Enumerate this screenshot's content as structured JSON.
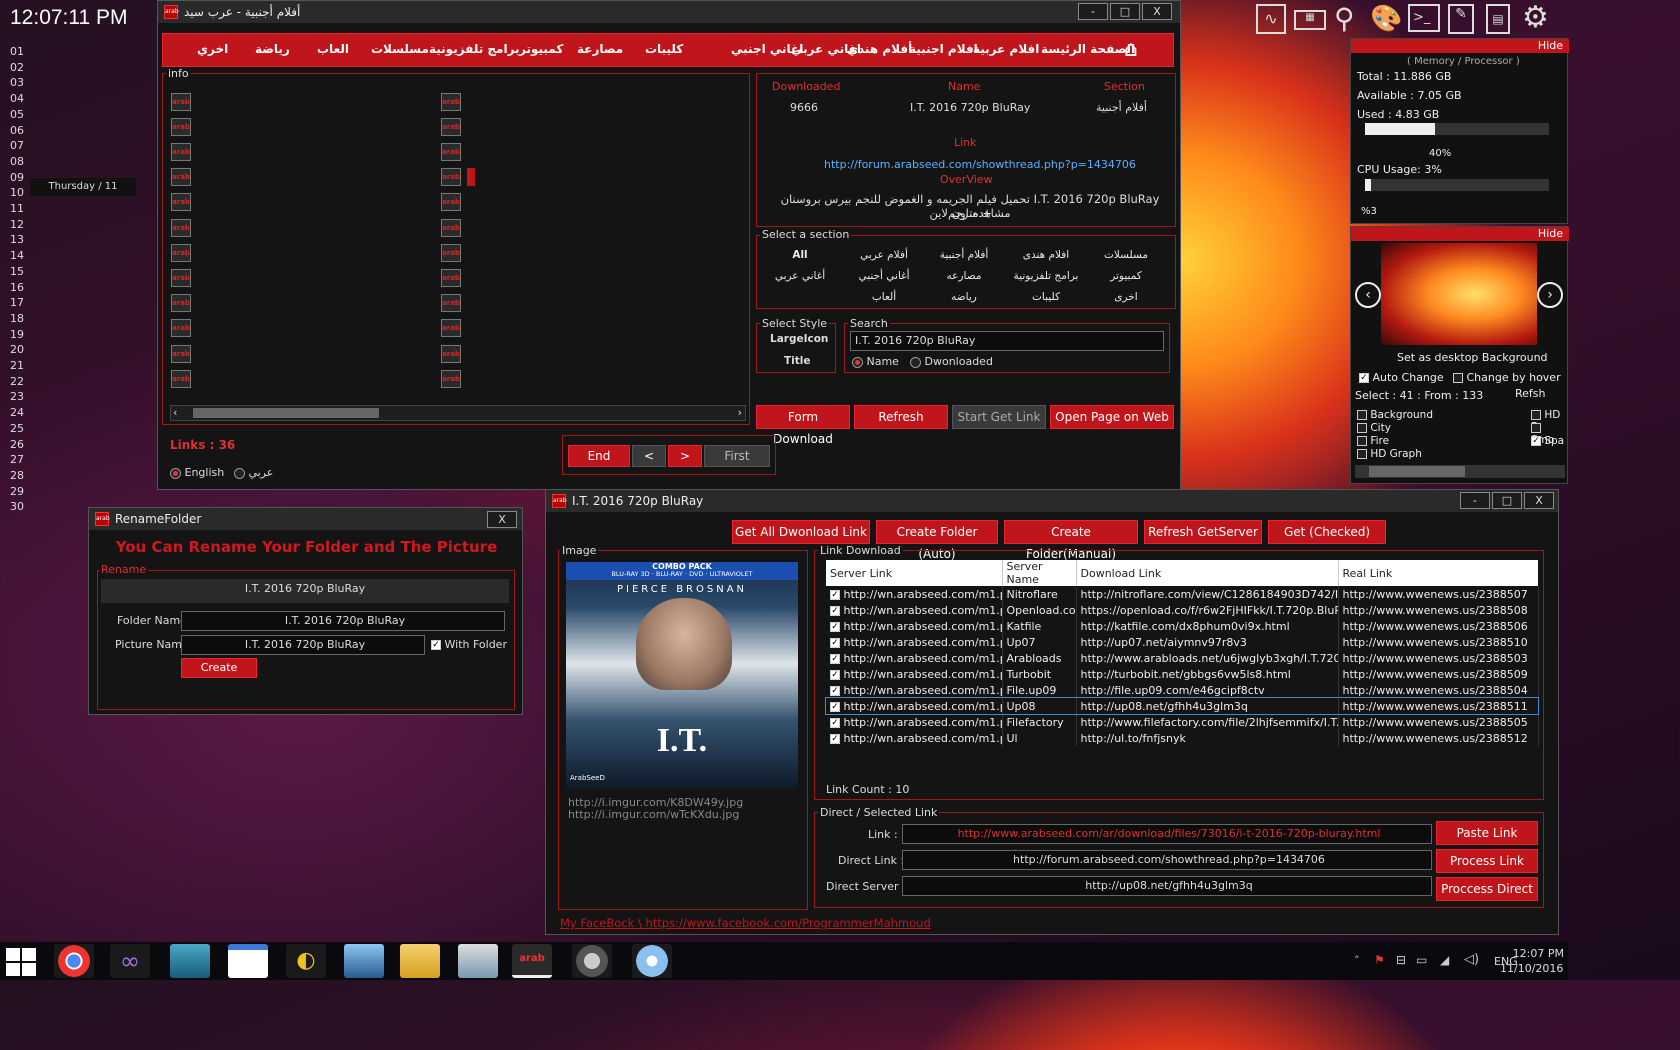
{
  "desktop": {
    "clock": "12:07:11 PM",
    "date_label": "Thursday / 11",
    "calendar_days": [
      "01",
      "02",
      "03",
      "04",
      "05",
      "06",
      "07",
      "08",
      "09",
      "10",
      "11",
      "12",
      "13",
      "14",
      "15",
      "16",
      "17",
      "18",
      "19",
      "20",
      "21",
      "22",
      "23",
      "24",
      "25",
      "26",
      "27",
      "28",
      "29",
      "30"
    ]
  },
  "main_window": {
    "title": "أفلام أجنبية - عرب سيد",
    "controls": [
      "-",
      "□",
      "X"
    ],
    "nav": [
      "الصفحة الرئيسة",
      "افلام عربية",
      "افلام اجنبية",
      "أفلام هندي",
      "اغاني عربي",
      "اغاني اجنبي",
      "كليبات",
      "مصارعة",
      "كمبيوتر",
      "برامج تلفزيونية",
      "مسلسلات",
      "العاب",
      "رياضة",
      "اخري"
    ],
    "info_label": "info",
    "list_left": [
      "فيلم اكشن و اثاره نسخ 720 40 BluRay",
      "فيلم اكشن و خيال علمي نسخ 720 30 BluRay",
      "Don't Breathe 2016 720p WEB-DL",
      "Attack of the Lederhosen Zombies 2016 HDRip",
      "The Secret Life of Pets 2016 BluRay",
      "Jack Reacher: Never Go Back 2016 HD-TS",
      "Kubo and the Two Strings 2016 720p WEB-DL",
      "Trolls 2016 HD-CAM",
      "Rupture 2016 HDRip",
      "Trash Fire 2016 HDRip",
      "Stagecoach The Texas Jack Story 2016 HDRip",
      "Bridget Jones Baby 2016 720p HC HDRip"
    ],
    "list_right": [
      "Cobra 1996 HD720p",
      "Hands of Stone 2016 720p BluRay",
      "La Corrispondenza 2016 720p BluRay",
      "I.T. 2016 720p BluRay",
      "سلسلة افلام The Expendables مترجمة جودة 720p",
      "Life on the Line 2015 720p BluRay",
      "Returned 2015 HDRip",
      "The Accountant 2016 HD-CAM",
      "Ouija: Origin of Evil 2016 HD-CAM",
      "The Darkest Dawn 2016 HDRip",
      "Boo! A Madea Halloween 2016 HD-TS",
      "Kevin Hart: What Now? 2016 HD-CAM"
    ],
    "selected_item": "I.T. 2016 720p BluRay",
    "detail": {
      "downloaded_h": "Downloaded",
      "name_h": "Name",
      "section_h": "Section",
      "downloaded": "9666",
      "name": "I.T. 2016 720p BluRay",
      "section": "أفلام أجنبية",
      "link_h": "Link",
      "link": "http://forum.arabseed.com/showthread.php?p=1434706",
      "overview_h": "OverView",
      "overview_1": "تحميل فيلم الجريمه و الغموض للنجم بيرس بروسنان I.T. 2016 720p BluRay مترجم +",
      "overview_2": "مشاهده اون لاين"
    },
    "select_section_label": "Select a section",
    "sections_row1": [
      "مسلسلات",
      "افلام هندى",
      "أفلام أجنبية",
      "أفلام عربي",
      "All"
    ],
    "sections_row2": [
      "كمبيوتر",
      "برامج تلفزيونية",
      "مصارعه",
      "أغاني أجنبي",
      "أغاني عربي"
    ],
    "sections_row3": [
      "اخرى",
      "كليبات",
      "رياضه",
      "ألعاب"
    ],
    "style_label": "Select Style",
    "style_options": [
      "LargeIcon",
      "Title"
    ],
    "search_label": "Search",
    "search_value": "I.T. 2016 720p BluRay",
    "search_opt_name": "Name",
    "search_opt_downloaded": "Dwonloaded",
    "buttons": {
      "form_download": "Form Download",
      "refresh": "Refresh",
      "start_get_link": "Start Get Link",
      "open_page": "Open Page on Web"
    },
    "links_count": "Links : 36",
    "lang_en": "English",
    "lang_ar": "عربي",
    "pager": {
      "end": "End",
      "prev": "<",
      "next": ">",
      "first": "First"
    }
  },
  "rename_window": {
    "title": "RenameFolder",
    "close": "X",
    "headline": "You Can Rename Your Folder and The Picture",
    "group": "Rename",
    "current": "I.T. 2016 720p BluRay",
    "folder_label": "Folder Name",
    "folder_value": "I.T. 2016 720p BluRay",
    "picture_label": "Picture Name",
    "picture_value": "I.T. 2016 720p BluRay",
    "with_folder": "With Folder",
    "create": "Create"
  },
  "detail_window": {
    "title": "I.T. 2016 720p BluRay",
    "controls": [
      "-",
      "□",
      "X"
    ],
    "buttons": [
      "Get All Dwonload Link",
      "Create Folder (Auto)",
      "Create Folder(Manual)",
      "Refresh GetServer",
      "Get (Checked)"
    ],
    "image_label": "Image",
    "poster": {
      "banner": "COMBO PACK",
      "sub": "BLU-RAY 3D · BLU-RAY · DVD · ULTRAVIOLET",
      "actor": "PIERCE BROSNAN",
      "title": "I.T.",
      "brand": "ArabSeeD"
    },
    "image_urls": [
      "http://i.imgur.com/K8DW49y.jpg",
      "http://i.imgur.com/wTcKXdu.jpg"
    ],
    "link_group": "Link Download",
    "columns": [
      "Server Link",
      "Server Name",
      "Download Link",
      "Real Link"
    ],
    "rows": [
      [
        "http://wn.arabseed.com/m1.p...",
        "Nitroflare",
        "http://nitroflare.com/view/C1286184903D742/I.T.7...",
        "http://www.wwenews.us/2388507"
      ],
      [
        "http://wn.arabseed.com/m1.p...",
        "Openload.co",
        "https://openload.co/f/r6w2FjHIFkk/I.T.720p.BluRay...",
        "http://www.wwenews.us/2388508"
      ],
      [
        "http://wn.arabseed.com/m1.p...",
        "Katfile",
        "http://katfile.com/dx8phum0vi9x.html",
        "http://www.wwenews.us/2388506"
      ],
      [
        "http://wn.arabseed.com/m1.p...",
        "Up07",
        "http://up07.net/aiymnv97r8v3",
        "http://www.wwenews.us/2388510"
      ],
      [
        "http://wn.arabseed.com/m1.p...",
        "Arabloads",
        "http://www.arabloads.net/u6jwglyb3xgh/I.T.720p.B...",
        "http://www.wwenews.us/2388503"
      ],
      [
        "http://wn.arabseed.com/m1.p...",
        "Turbobit",
        "http://turbobit.net/gbbgs6vw5ls8.html",
        "http://www.wwenews.us/2388509"
      ],
      [
        "http://wn.arabseed.com/m1.p...",
        "File.up09",
        "http://file.up09.com/e46gcipf8ctv",
        "http://www.wwenews.us/2388504"
      ],
      [
        "http://wn.arabseed.com/m1.p...",
        "Up08",
        "http://up08.net/gfhh4u3glm3q",
        "http://www.wwenews.us/2388511"
      ],
      [
        "http://wn.arabseed.com/m1.p...",
        "Filefactory",
        "http://www.filefactory.com/file/2lhjfsemmifx/I.T.720...",
        "http://www.wwenews.us/2388505"
      ],
      [
        "http://wn.arabseed.com/m1.p...",
        "Ul",
        "http://ul.to/fnfjsnyk",
        "http://www.wwenews.us/2388512"
      ]
    ],
    "link_count": "Link Count : 10",
    "direct_group": "Direct / Selected Link",
    "link_label": "Link :",
    "link_value": "http://www.arabseed.com/ar/download/files/73016/i-t-2016-720p-bluray.html",
    "direct_link_label": "Direct Link :",
    "direct_link_value": "http://forum.arabseed.com/showthread.php?p=1434706",
    "direct_server_label": "Direct Server :",
    "direct_server_value": "http://up08.net/gfhh4u3glm3q",
    "paste": "Paste Link",
    "process": "Process Link",
    "process_direct": "Proccess Direct",
    "facebook": "My FaceBock \\ https://www.facebook.com/ProgrammerMahmoud"
  },
  "sidebar": {
    "hide": "Hide",
    "mem_title": "( Memory / Processor )",
    "total": "Total : 11.886 GB",
    "available": "Available : 7.05 GB",
    "used": "Used : 4.83 GB",
    "mem_pct": "40%",
    "mem_fraction": 0.4,
    "cpu": "CPU Usage: 3%",
    "cpu_pct": "%3",
    "cpu_fraction": 0.03,
    "hide2": "Hide",
    "set_bg": "Set as desktop Background",
    "auto_change": "Auto Change",
    "change_hover": "Change by hover",
    "select_info": "Select : 41 : From : 133",
    "refresh": "Refsh",
    "categories_left": [
      "Background",
      "City",
      "Fire",
      "HD Graph"
    ],
    "categories_right": [
      "HD F",
      "Smo",
      "Spa"
    ]
  },
  "taskbar": {
    "lang": "ENG",
    "time": "12:07 PM",
    "date": "11/10/2016"
  }
}
